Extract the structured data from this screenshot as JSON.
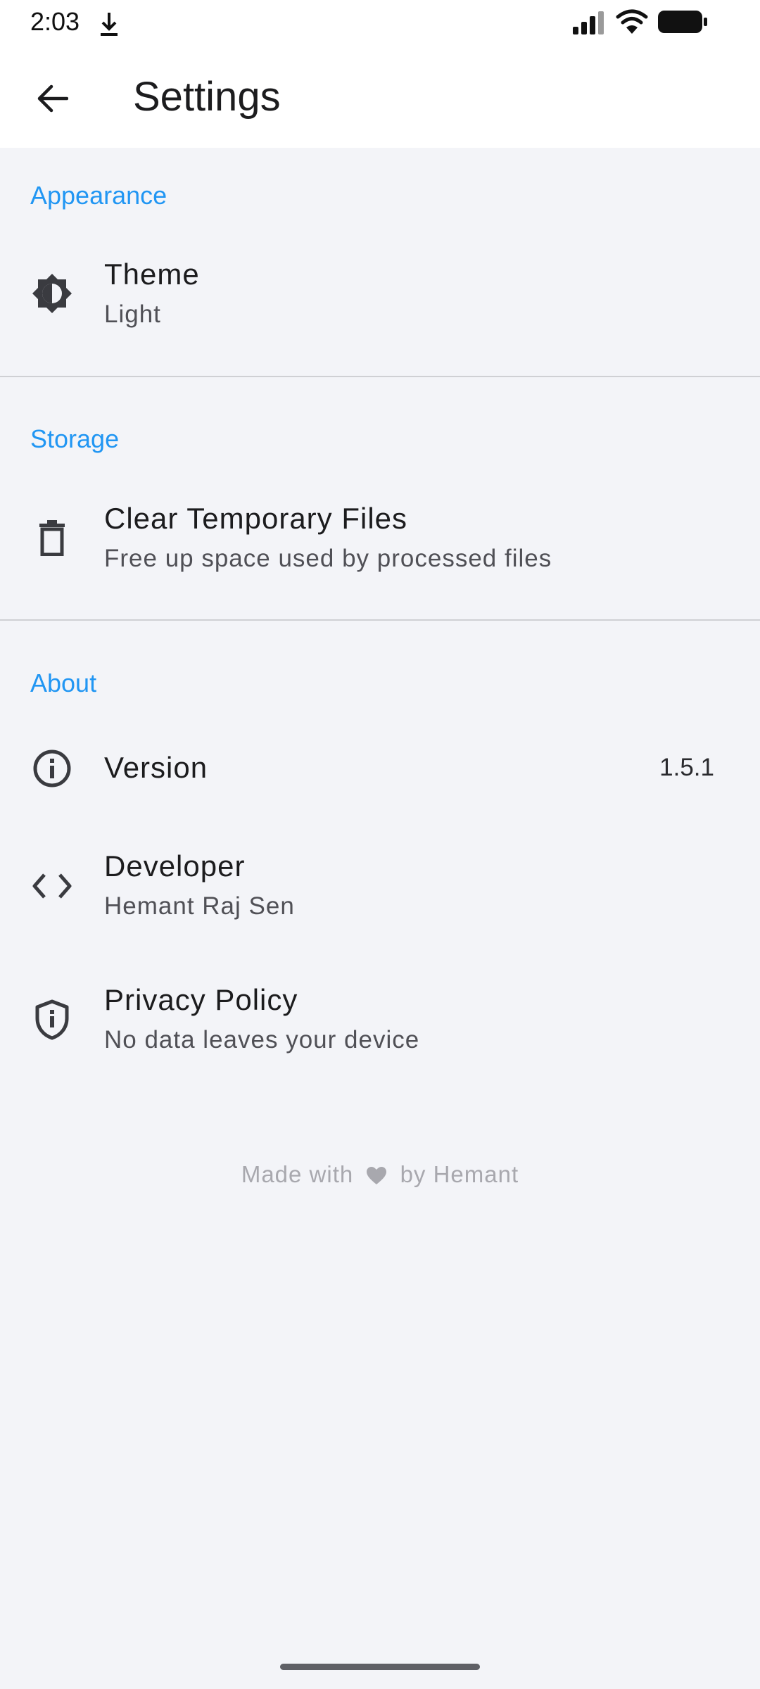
{
  "status_bar": {
    "time": "2:03",
    "icons": [
      "download-icon",
      "signal-icon",
      "wifi-icon",
      "battery-icon"
    ]
  },
  "app_bar": {
    "title": "Settings",
    "back_icon": "arrow-back-icon"
  },
  "sections": {
    "appearance": {
      "header": "Appearance",
      "items": [
        {
          "icon": "brightness-icon",
          "title": "Theme",
          "subtitle": "Light"
        }
      ]
    },
    "storage": {
      "header": "Storage",
      "items": [
        {
          "icon": "trash-icon",
          "title": "Clear Temporary Files",
          "subtitle": "Free up space used by processed files"
        }
      ]
    },
    "about": {
      "header": "About",
      "items": [
        {
          "icon": "info-icon",
          "title": "Version",
          "value": "1.5.1"
        },
        {
          "icon": "code-icon",
          "title": "Developer",
          "subtitle": "Hemant Raj Sen"
        },
        {
          "icon": "shield-icon",
          "title": "Privacy Policy",
          "subtitle": "No data leaves your device"
        }
      ]
    }
  },
  "footer": {
    "prefix": "Made with",
    "icon": "heart-icon",
    "suffix": "by Hemant"
  },
  "colors": {
    "accent": "#2196f3",
    "background": "#f3f4f8",
    "surface": "#ffffff",
    "divider": "#cfd0d4",
    "icon": "#3a3b40",
    "footer_text": "#a8a8ae"
  }
}
